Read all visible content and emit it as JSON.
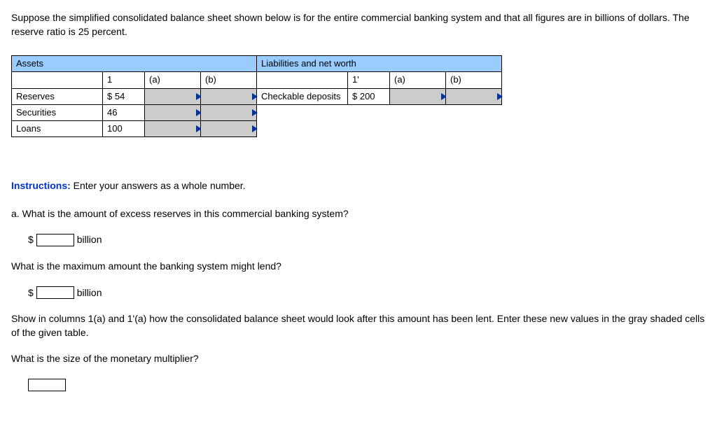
{
  "intro": "Suppose the simplified consolidated balance sheet shown below is for the entire commercial banking system and that all figures are in billions of dollars. The reserve ratio is 25 percent.",
  "table": {
    "assets_header": "Assets",
    "liab_header": "Liabilities and net worth",
    "col1": "1",
    "cola": "(a)",
    "colb": "(b)",
    "col1p": "1'",
    "rows": {
      "reserves_label": "Reserves",
      "reserves_val": "$     54",
      "securities_label": "Securities",
      "securities_val": "46",
      "loans_label": "Loans",
      "loans_val": "100",
      "checkable_label": "Checkable deposits",
      "checkable_val": "$    200"
    }
  },
  "instructions_label": "Instructions:",
  "instructions_text": " Enter your answers as a whole number.",
  "qa": {
    "q_a": "a. What is the amount of excess reserves in this commercial banking system?",
    "billion": "billion",
    "q_lend": "What is the maximum amount the banking system might lend?",
    "show_text": "Show in columns 1(a) and 1'(a) how the consolidated balance sheet would look after this amount has been lent. Enter these new values in the gray shaded cells of the given table.",
    "q_mult": "What is the size of the monetary multiplier?"
  },
  "chart_data": {
    "type": "table",
    "title": "Simplified consolidated balance sheet (billions of dollars)",
    "reserve_ratio_percent": 25,
    "assets": [
      {
        "item": "Reserves",
        "value": 54
      },
      {
        "item": "Securities",
        "value": 46
      },
      {
        "item": "Loans",
        "value": 100
      }
    ],
    "liabilities_and_net_worth": [
      {
        "item": "Checkable deposits",
        "value": 200
      }
    ]
  }
}
